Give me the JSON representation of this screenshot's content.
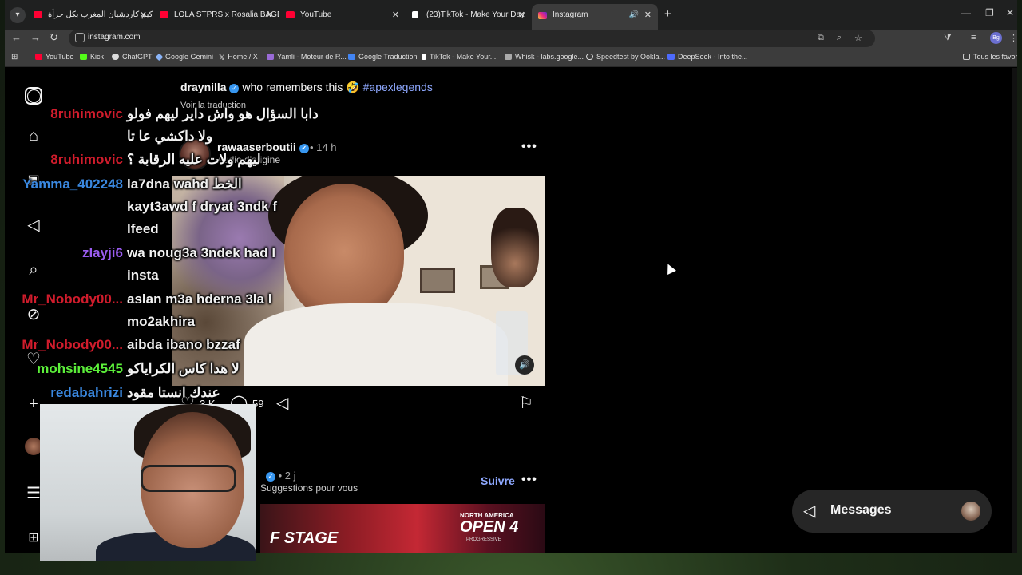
{
  "browser": {
    "tabs": [
      {
        "title": "كيم كاردشيان المغرب بكل جرأة...",
        "favicon_color": "#ff0033",
        "active": false
      },
      {
        "title": "LOLA STPRS x Rosalia BAGDAD",
        "favicon_color": "#ff0033",
        "active": false
      },
      {
        "title": "YouTube",
        "favicon_color": "#ff0033",
        "active": false
      },
      {
        "title": "(23)TikTok - Make Your Day",
        "favicon_color": "#ffffff",
        "active": false
      },
      {
        "title": "Instagram",
        "favicon_color": "#e1306c",
        "active": true
      }
    ],
    "url": "instagram.com",
    "profile_initials": "Bg",
    "bookmarks": [
      {
        "label": "YouTube",
        "color": "#ff0033"
      },
      {
        "label": "Kick",
        "color": "#53fc18"
      },
      {
        "label": "ChatGPT",
        "color": "#dddddd"
      },
      {
        "label": "Google Gemini",
        "color": "#8ab4f8"
      },
      {
        "label": "Home / X",
        "color": "#ffffff"
      },
      {
        "label": "Yamli - Moteur de R...",
        "color": "#9a6bd8"
      },
      {
        "label": "Google Traduction",
        "color": "#4285f4"
      },
      {
        "label": "TikTok - Make Your...",
        "color": "#ffffff"
      },
      {
        "label": "Whisk - labs.google...",
        "color": "#aaaaaa"
      },
      {
        "label": "Speedtest by Ookla...",
        "color": "#dddddd"
      },
      {
        "label": "DeepSeek - Into the...",
        "color": "#4d6bfe"
      }
    ],
    "bookmarks_all": "Tous les favoris"
  },
  "feed": {
    "prev_post": {
      "user": "draynilla",
      "caption_text": "who remembers this",
      "caption_emoji": "🤣",
      "hashtag": "#apexlegends",
      "translate": "Voir la traduction"
    },
    "post": {
      "user": "rawaaserboutii",
      "time": "14 h",
      "audio": "Audio d'origine",
      "likes_short": "3 K",
      "comments_short": "59"
    },
    "next_post": {
      "time": "2 j",
      "suggest": "Suggestions pour vous",
      "follow": "Suivre",
      "banner_left": "F STAGE",
      "banner_region": "NORTH AMERICA",
      "banner_title": "OPEN 4",
      "banner_sub": "PROGRESSIVE"
    },
    "messages_label": "Messages"
  },
  "chat": [
    {
      "name": "8ruhimovic",
      "color": "#d01c2c",
      "text": "دابا السؤال هو واش داير ليهم فولو"
    },
    {
      "name": "",
      "color": "#d01c2c",
      "text": "ولا داكشي عا تا"
    },
    {
      "name": "8ruhimovic",
      "color": "#d01c2c",
      "text": "ليهم ولات عليه الرقابة ؟"
    },
    {
      "name": "Yamma_402248",
      "color": "#3a88e0",
      "text": "la7dna wahd الخط"
    },
    {
      "name": "",
      "color": "#3a88e0",
      "text": "kayt3awd f dryat 3ndk f"
    },
    {
      "name": "",
      "color": "#3a88e0",
      "text": "lfeed"
    },
    {
      "name": "zlayji6",
      "color": "#9a5cf0",
      "text": "wa noug3a 3ndek had l"
    },
    {
      "name": "",
      "color": "#9a5cf0",
      "text": "insta"
    },
    {
      "name": "Mr_Nobody00...",
      "color": "#d01c2c",
      "text": "aslan m3a hderna 3la l"
    },
    {
      "name": "",
      "color": "#d01c2c",
      "text": "mo2akhira"
    },
    {
      "name": "Mr_Nobody00...",
      "color": "#d01c2c",
      "text": "aibda ibano bzzaf"
    },
    {
      "name": "mohsine4545",
      "color": "#5cf03a",
      "text": "لا هدا كاس الكراياكو"
    },
    {
      "name": "redabahrizi",
      "color": "#3a88e0",
      "text": "عندك انستا مقود"
    }
  ]
}
